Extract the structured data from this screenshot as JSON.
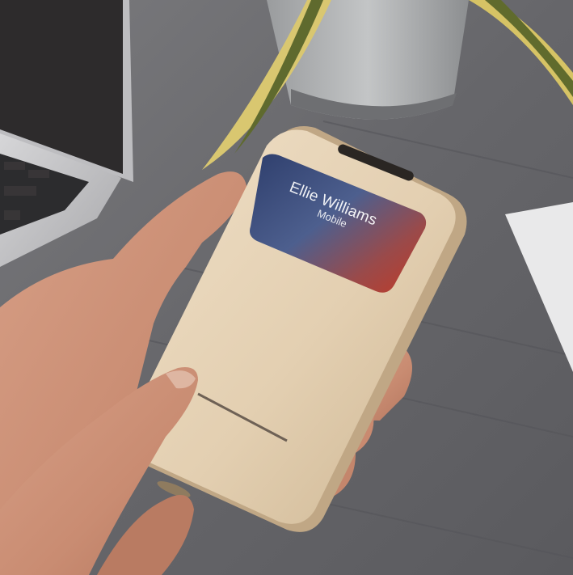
{
  "screen": {
    "caller_name": "Ellie Williams",
    "caller_type": "Mobile"
  },
  "colors": {
    "case": "#e5d2b5",
    "felt": "#68686b",
    "window_left": "#3d4f7a",
    "window_right": "#b5392a"
  }
}
